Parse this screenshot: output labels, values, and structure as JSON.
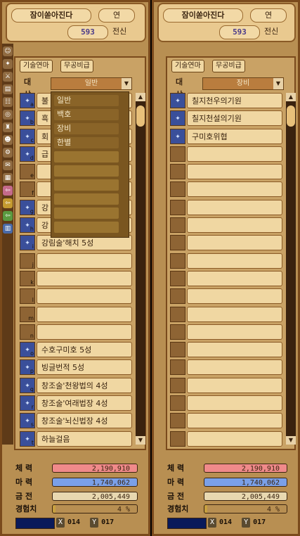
{
  "player": {
    "name": "잠이쏟아진다",
    "tab": "연",
    "level": "593",
    "rebirth": "전신"
  },
  "tabs": {
    "skills": "기술연마",
    "martial": "무공비급"
  },
  "target_label": "대 상",
  "left": {
    "selected": "일반",
    "dropdown": [
      "일반",
      "백호",
      "장비",
      "한별"
    ],
    "rows": [
      {
        "letter": "a",
        "label": "불",
        "skill": true
      },
      {
        "letter": "b",
        "label": "흑",
        "skill": true
      },
      {
        "letter": "c",
        "label": "회",
        "skill": true
      },
      {
        "letter": "d",
        "label": "급",
        "skill": true
      },
      {
        "letter": "e",
        "label": "",
        "skill": false
      },
      {
        "letter": "f",
        "label": "",
        "skill": false
      },
      {
        "letter": "g",
        "label": "강",
        "skill": true
      },
      {
        "letter": "h",
        "label": "강",
        "skill": true
      },
      {
        "letter": "i",
        "label": "강림술'해치 5성",
        "skill": true
      },
      {
        "letter": "j",
        "label": "",
        "skill": false
      },
      {
        "letter": "k",
        "label": "",
        "skill": false
      },
      {
        "letter": "l",
        "label": "",
        "skill": false
      },
      {
        "letter": "m",
        "label": "",
        "skill": false
      },
      {
        "letter": "n",
        "label": "",
        "skill": false
      },
      {
        "letter": "o",
        "label": "수호구미호 5성",
        "skill": true
      },
      {
        "letter": "p",
        "label": "빙글번적 5성",
        "skill": true
      },
      {
        "letter": "q",
        "label": "창조술'천왕법의 4성",
        "skill": true
      },
      {
        "letter": "r",
        "label": "창조술'여래법장 4성",
        "skill": true
      },
      {
        "letter": "s",
        "label": "창조술'뇌신법장 4성",
        "skill": true
      },
      {
        "letter": "t",
        "label": "하늘걸음",
        "skill": true
      }
    ]
  },
  "right": {
    "selected": "장비",
    "rows": [
      {
        "label": "칠지천우의기원",
        "skill": true
      },
      {
        "label": "칠지천설의기원",
        "skill": true
      },
      {
        "label": "구미호위협",
        "skill": true
      },
      {
        "label": "",
        "skill": false
      },
      {
        "label": "",
        "skill": false
      },
      {
        "label": "",
        "skill": false
      },
      {
        "label": "",
        "skill": false
      },
      {
        "label": "",
        "skill": false
      },
      {
        "label": "",
        "skill": false
      },
      {
        "label": "",
        "skill": false
      },
      {
        "label": "",
        "skill": false
      },
      {
        "label": "",
        "skill": false
      },
      {
        "label": "",
        "skill": false
      },
      {
        "label": "",
        "skill": false
      },
      {
        "label": "",
        "skill": false
      },
      {
        "label": "",
        "skill": false
      },
      {
        "label": "",
        "skill": false
      },
      {
        "label": "",
        "skill": false
      },
      {
        "label": "",
        "skill": false
      },
      {
        "label": "",
        "skill": false
      }
    ]
  },
  "stats": {
    "hp_label": "체 력",
    "hp": "2,190,910",
    "mp_label": "마 력",
    "mp": "1,740,062",
    "gold_label": "금 전",
    "gold": "2,005,449",
    "exp_label": "경험치",
    "exp": "4 %",
    "exp_fraction": 0.04,
    "x_label": "X",
    "x": "014",
    "y_label": "Y",
    "y": "017"
  },
  "colors": {
    "hp": "#f08a8a",
    "mp": "#7aa0e8",
    "frame": "#7a4a1c",
    "panel": "#c9a265"
  }
}
